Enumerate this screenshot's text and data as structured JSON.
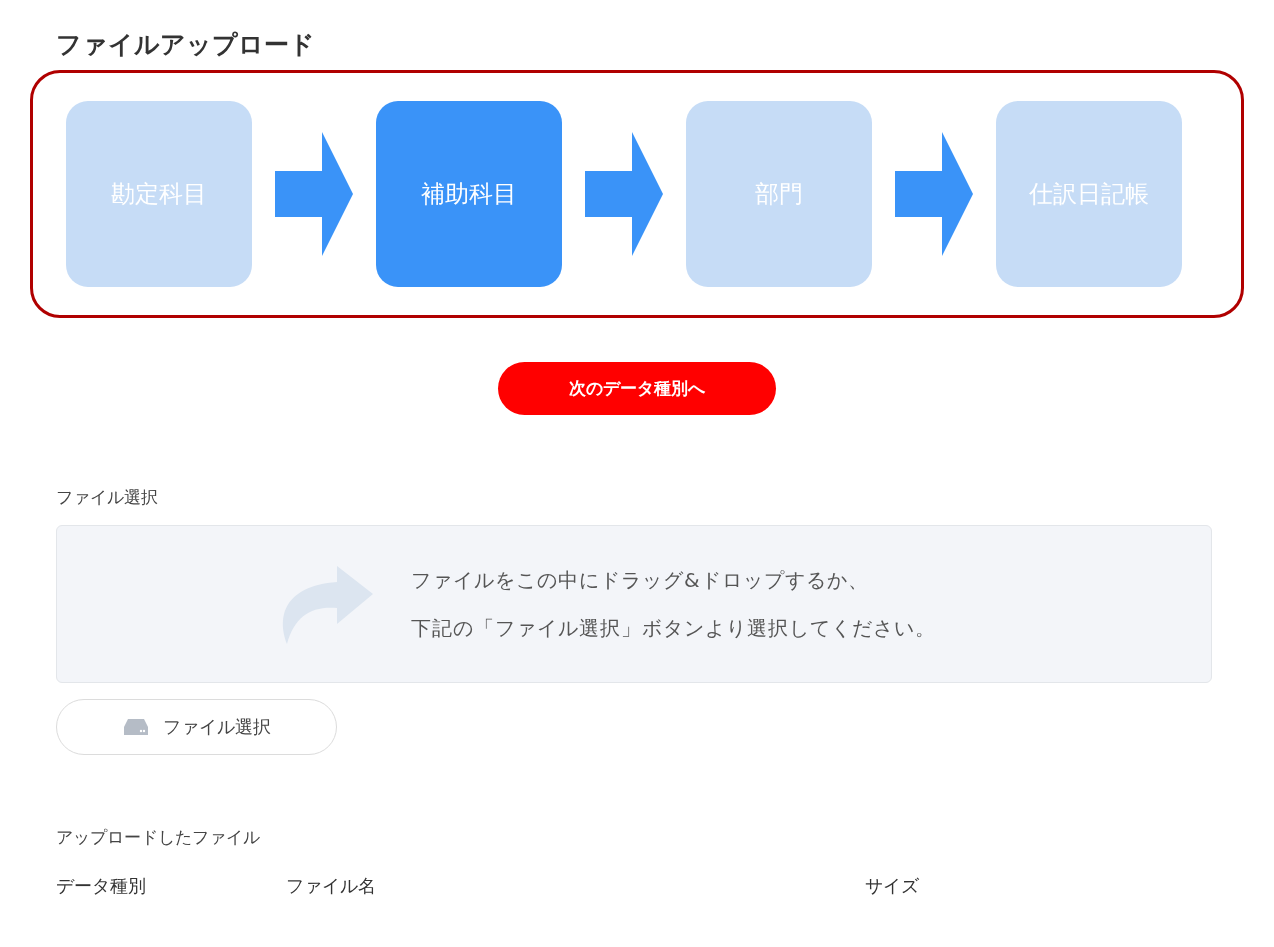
{
  "title": "ファイルアップロード",
  "steps": [
    {
      "label": "勘定科目",
      "selected": false
    },
    {
      "label": "補助科目",
      "selected": true
    },
    {
      "label": "部門",
      "selected": false
    },
    {
      "label": "仕訳日記帳",
      "selected": false
    }
  ],
  "next_button": "次のデータ種別へ",
  "file_select": {
    "label": "ファイル選択",
    "drop_text": [
      "ファイルをこの中にドラッグ&ドロップするか、",
      "下記の「ファイル選択」ボタンより選択してください。"
    ],
    "button": "ファイル選択"
  },
  "uploaded": {
    "label": "アップロードしたファイル",
    "columns": [
      "データ種別",
      "ファイル名",
      "サイズ"
    ]
  }
}
